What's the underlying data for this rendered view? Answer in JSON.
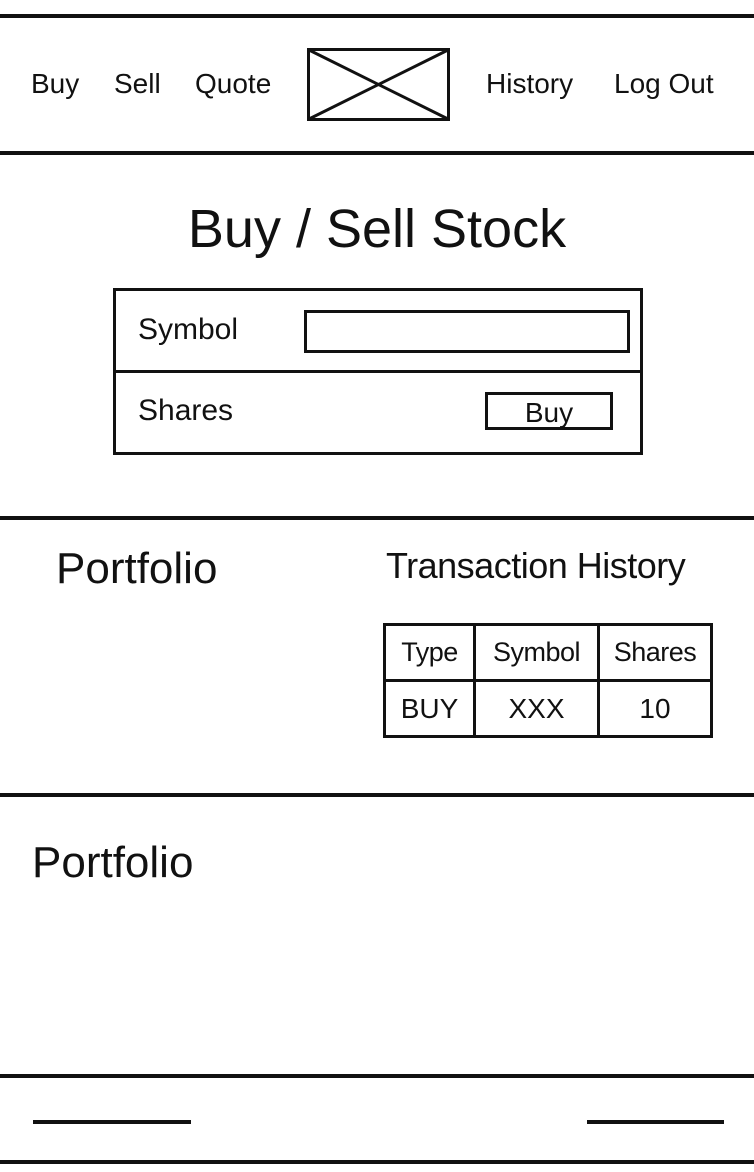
{
  "nav": {
    "buy": "Buy",
    "sell": "Sell",
    "quote": "Quote",
    "logo": "image-placeholder-icon",
    "history": "History",
    "logout": "Log Out"
  },
  "trade": {
    "title": "Buy / Sell Stock",
    "symbol_label": "Symbol",
    "symbol_value": "",
    "shares_label": "Shares",
    "buy_button": "Buy"
  },
  "summary": {
    "portfolio_heading": "Portfolio",
    "history_heading": "Transaction History",
    "history_table": {
      "columns": [
        "Type",
        "Symbol",
        "Shares"
      ],
      "rows": [
        [
          "BUY",
          "XXX",
          "10"
        ]
      ]
    }
  },
  "portfolio": {
    "heading": "Portfolio"
  },
  "footer": {
    "left_link": "footer-line-placeholder",
    "right_link": "footer-line-placeholder"
  },
  "colors": {
    "ink": "#111111",
    "background": "#ffffff"
  }
}
